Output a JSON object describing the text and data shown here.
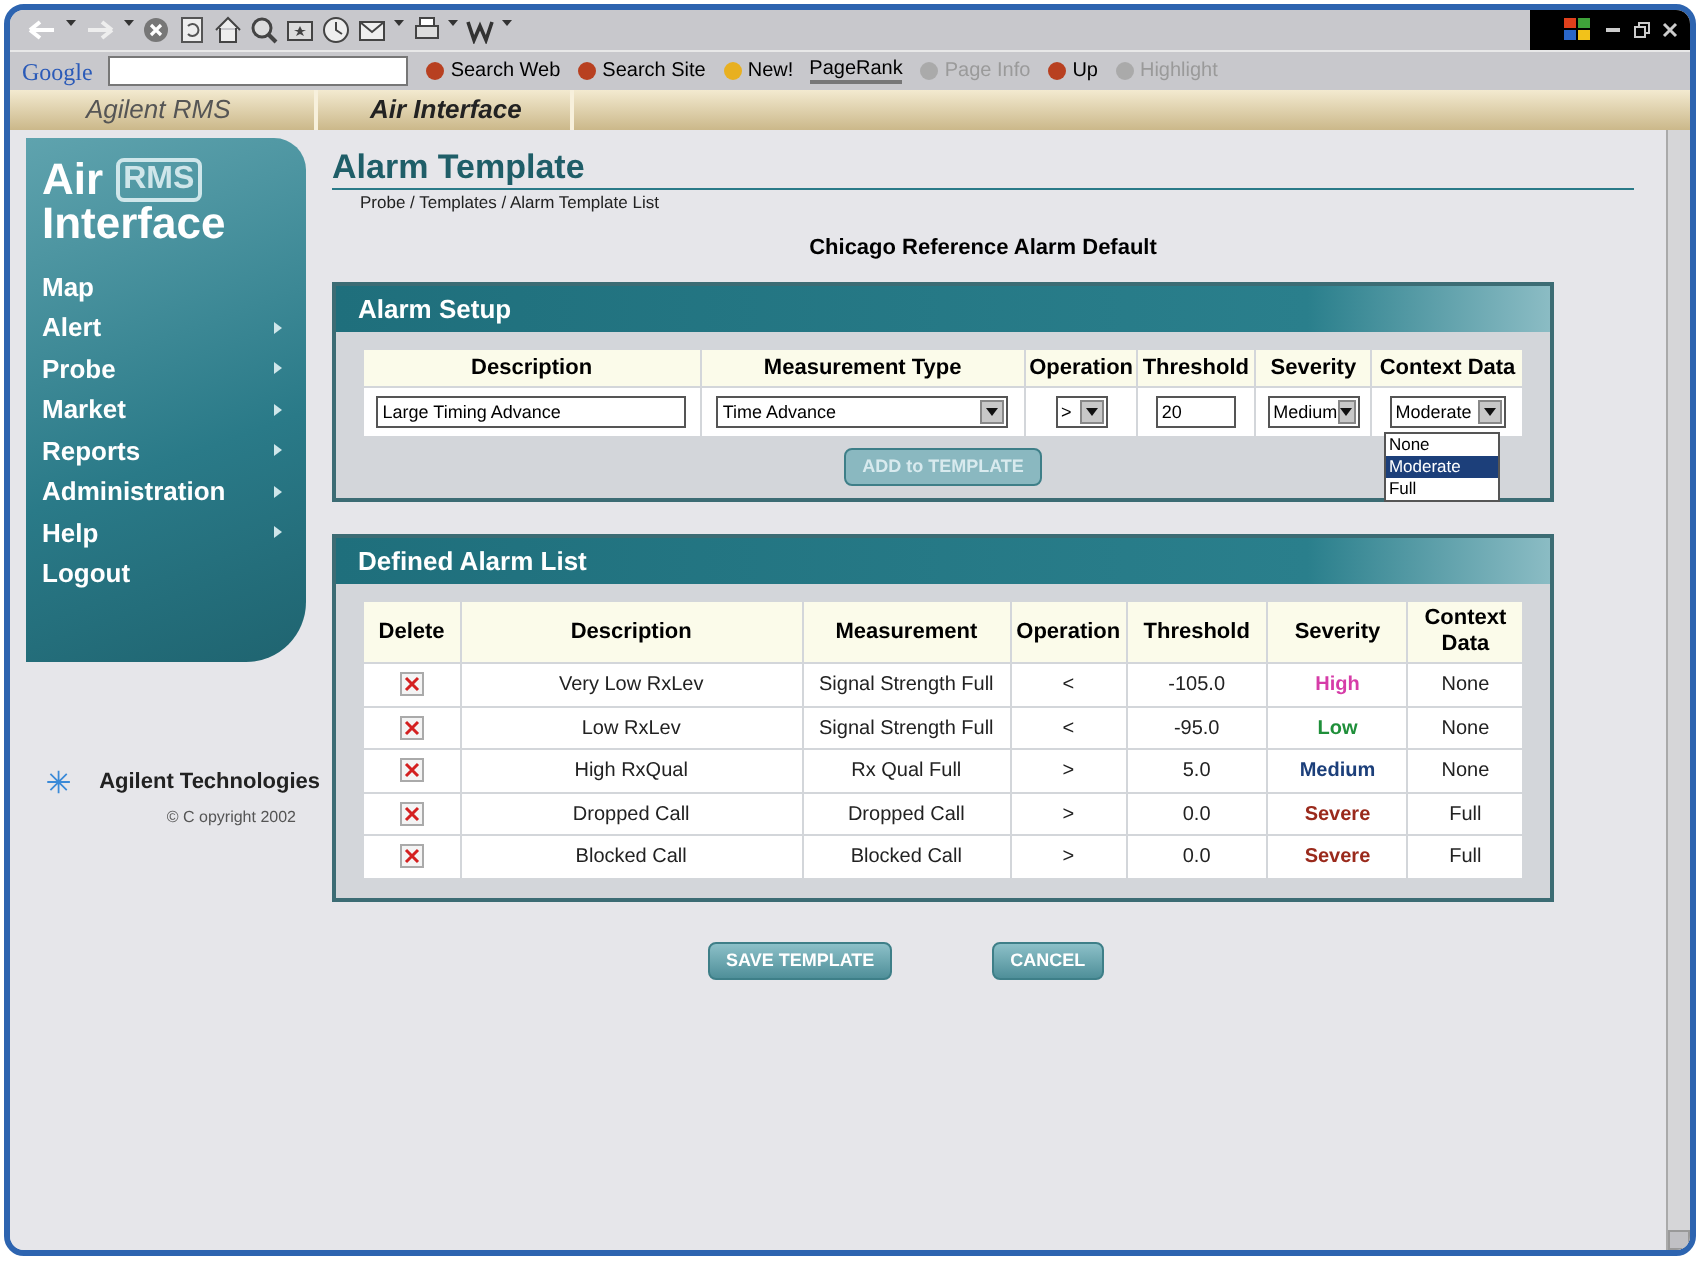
{
  "google_toolbar": {
    "logo": "Google",
    "buttons": [
      {
        "label": "Search Web",
        "disabled": false
      },
      {
        "label": "Search Site",
        "disabled": false
      },
      {
        "label": "New!",
        "disabled": false
      },
      {
        "label": "PageRank",
        "disabled": false
      },
      {
        "label": "Page Info",
        "disabled": true
      },
      {
        "label": "Up",
        "disabled": false
      },
      {
        "label": "Highlight",
        "disabled": true
      }
    ]
  },
  "header_tabs": [
    {
      "label": "Agilent RMS",
      "selected": false
    },
    {
      "label": "Air Interface",
      "selected": true
    }
  ],
  "sidebar": {
    "logo": {
      "line_1": "Air",
      "badge": "RMS",
      "line_2": "Interface"
    },
    "items": [
      {
        "label": "Map",
        "submenu": false
      },
      {
        "label": "Alert",
        "submenu": true
      },
      {
        "label": "Probe",
        "submenu": true
      },
      {
        "label": "Market",
        "submenu": true
      },
      {
        "label": "Reports",
        "submenu": true
      },
      {
        "label": "Administration",
        "submenu": true
      },
      {
        "label": "Help",
        "submenu": true
      },
      {
        "label": "Logout",
        "submenu": false
      }
    ],
    "company": "Agilent Technologies",
    "copyright": "© C opyright 2002"
  },
  "page": {
    "title": "Alarm Template",
    "breadcrumb": "Probe / Templates / Alarm Template List",
    "subtitle": "Chicago Reference Alarm Default"
  },
  "alarm_setup": {
    "title": "Alarm Setup",
    "columns": [
      "Description",
      "Measurement Type",
      "Operation",
      "Threshold",
      "Severity",
      "Context Data"
    ],
    "description": "Large Timing Advance",
    "measurement_type": "Time Advance",
    "operation": ">",
    "threshold": "20",
    "severity": "Medium",
    "context_data": "Moderate",
    "context_options": [
      {
        "label": "None",
        "selected": false
      },
      {
        "label": "Moderate",
        "selected": true
      },
      {
        "label": "Full",
        "selected": false
      }
    ],
    "add_button": {
      "label": "ADD to TEMPLATE",
      "disabled": true
    }
  },
  "alarm_list": {
    "title": "Defined Alarm List",
    "columns": [
      "Delete",
      "Description",
      "Measurement",
      "Operation",
      "Threshold",
      "Severity",
      "Context Data"
    ],
    "rows": [
      {
        "description": "Very Low RxLev",
        "measurement": "Signal Strength Full",
        "operation": "<",
        "threshold": "-105.0",
        "severity": "High",
        "color": "#d63ca8",
        "context_data": "None"
      },
      {
        "description": "Low RxLev",
        "measurement": "Signal Strength Full",
        "operation": "<",
        "threshold": "-95.0",
        "severity": "Low",
        "color": "#1f8f3a",
        "context_data": "None"
      },
      {
        "description": "High RxQual",
        "measurement": "Rx Qual Full",
        "operation": ">",
        "threshold": "5.0",
        "severity": "Medium",
        "color": "#1c3f7a",
        "context_data": "None"
      },
      {
        "description": "Dropped Call",
        "measurement": "Dropped Call",
        "operation": ">",
        "threshold": "0.0",
        "severity": "Severe",
        "color": "#9a2a1c",
        "context_data": "Full"
      },
      {
        "description": "Blocked Call",
        "measurement": "Blocked Call",
        "operation": ">",
        "threshold": "0.0",
        "severity": "Severe",
        "color": "#9a2a1c",
        "context_data": "Full"
      }
    ]
  },
  "buttons": [
    "SAVE TEMPLATE",
    "CANCEL"
  ]
}
